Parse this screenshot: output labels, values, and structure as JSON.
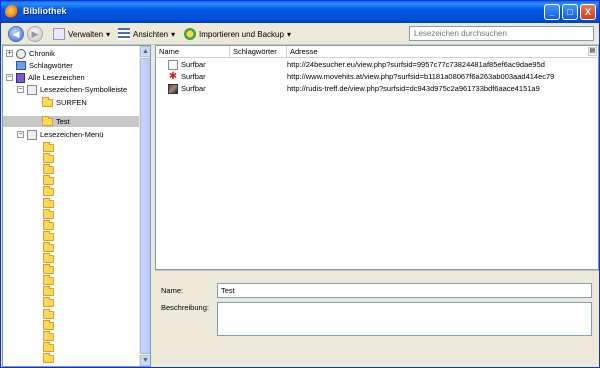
{
  "window": {
    "title": "Bibliothek",
    "controls": [
      "_",
      "□",
      "X"
    ]
  },
  "toolbar": {
    "back_glyph": "◀",
    "forward_glyph": "▶",
    "organize_label": "Verwalten",
    "views_label": "Ansichten",
    "import_label": "Importieren und Backup",
    "dropdown_glyph": "▾",
    "search_placeholder": "Lesezeichen durchsuchen"
  },
  "tree": {
    "history": "Chronik",
    "tags": "Schlagwörter",
    "all_bookmarks": "Alle Lesezeichen",
    "toolbar_folder": "Lesezeichen-Symbolleiste",
    "surfen_folder": "SURFEN",
    "test_folder": "Test",
    "menu_folder": "Lesezeichen-Menü",
    "expand_glyph": "+",
    "collapse_glyph": "−",
    "menu_subfolder_count": 20
  },
  "columns": {
    "name": "Name",
    "tags": "Schlagwörter",
    "address": "Adresse"
  },
  "bookmarks": [
    {
      "name": "Surfbar",
      "address": "http://24besucher.eu/view.php?surfsid=9957c77c73824481af85ef6ac9dae95d",
      "icon": "page-icon"
    },
    {
      "name": "Surfbar",
      "address": "http://www.movehits.at/view.php?surfsid=b1181a08067f6a263ab003aad414ec79",
      "icon": "red-star-icon"
    },
    {
      "name": "Surfbar",
      "address": "http://rudis-treff.de/view.php?surfsid=dc943d975c2a961733bdf6aace4151a9",
      "icon": "photo-icon"
    }
  ],
  "details": {
    "name_label": "Name:",
    "name_value": "Test",
    "description_label": "Beschreibung:",
    "description_value": ""
  },
  "colors": {
    "titlebar": "#0054e3",
    "selection": "#c7c7c7",
    "folder": "#ffd85a",
    "input_border": "#7f9db9"
  }
}
